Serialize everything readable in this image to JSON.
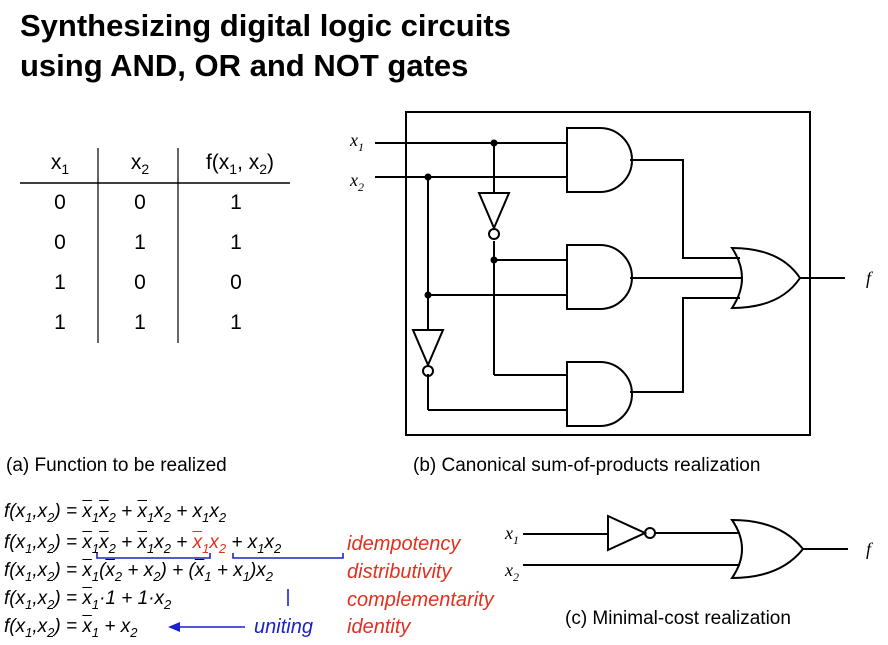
{
  "title": {
    "line1": "Synthesizing digital logic circuits",
    "line2": "using AND, OR and NOT gates"
  },
  "truth_table": {
    "headers": [
      {
        "main": "x",
        "sub": "1"
      },
      {
        "main": "x",
        "sub": "2"
      },
      {
        "main": "f(x",
        "sub": "1",
        "mid": ", x",
        "sub2": "2",
        "end": ")"
      }
    ],
    "rows": [
      [
        "0",
        "0",
        "1"
      ],
      [
        "0",
        "1",
        "1"
      ],
      [
        "1",
        "0",
        "0"
      ],
      [
        "1",
        "1",
        "1"
      ]
    ]
  },
  "captions": {
    "a": "(a) Function to be realized",
    "b": "(b) Canonical sum-of-products realization",
    "c": "(c) Minimal-cost realization"
  },
  "circuit_b": {
    "input1": "x",
    "input1_sub": "1",
    "input2": "x",
    "input2_sub": "2",
    "output": "f"
  },
  "circuit_c": {
    "input1": "x",
    "input1_sub": "1",
    "input2": "x",
    "input2_sub": "2",
    "output": "f"
  },
  "laws": {
    "idempotency": "idempotency",
    "distributivity": "distributivity",
    "complementarity": "complementarity",
    "identity": "identity",
    "uniting": "uniting"
  },
  "colors": {
    "law_text": "#e0301e",
    "uniting": "#1a22c8",
    "bracket": "#1a22c8"
  }
}
